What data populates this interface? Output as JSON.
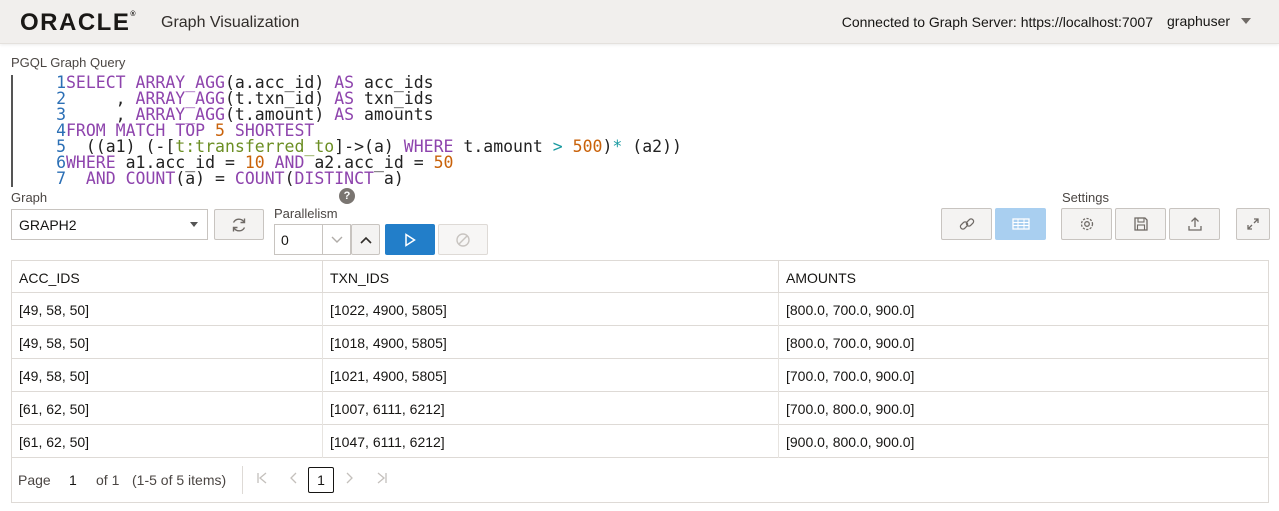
{
  "header": {
    "logo": "ORACLE",
    "logo_mark": "®",
    "app_title": "Graph Visualization",
    "connection": "Connected to Graph Server: https://localhost:7007",
    "user": "graphuser"
  },
  "query": {
    "label": "PGQL Graph Query",
    "lines": [
      {
        "n": "1",
        "parts": [
          "SELECT ",
          "ARRAY_AGG",
          "(a.acc_id) ",
          "AS",
          " acc_ids"
        ]
      },
      {
        "n": "2",
        "parts": [
          "     , ",
          "ARRAY_AGG",
          "(t.txn_id) ",
          "AS",
          " txn_ids"
        ]
      },
      {
        "n": "3",
        "parts": [
          "     , ",
          "ARRAY_AGG",
          "(t.amount) ",
          "AS",
          " amounts"
        ]
      },
      {
        "n": "4",
        "parts": [
          "FROM MATCH TOP ",
          "5",
          " SHORTEST"
        ]
      },
      {
        "n": "5",
        "parts": [
          "  ((a1) (-[",
          "t:transferred_to",
          "]->(a) ",
          "WHERE",
          " t.amount ",
          ">",
          " ",
          "500",
          ")",
          "*",
          " (a2))"
        ]
      },
      {
        "n": "6",
        "parts": [
          "WHERE",
          " a1.acc_id = ",
          "10",
          " ",
          "AND",
          " a2.acc_id = ",
          "50"
        ]
      },
      {
        "n": "7",
        "parts": [
          "  ",
          "AND COUNT",
          "(a) = ",
          "COUNT",
          "(",
          "DISTINCT",
          " a)"
        ]
      }
    ]
  },
  "controls": {
    "graph_label": "Graph",
    "graph_value": "GRAPH2",
    "parallelism_label": "Parallelism",
    "parallelism_value": "0",
    "help": "?",
    "settings_label": "Settings"
  },
  "table": {
    "columns": [
      "ACC_IDS",
      "TXN_IDS",
      "AMOUNTS"
    ],
    "rows": [
      [
        "[49, 58, 50]",
        "[1022, 4900, 5805]",
        "[800.0, 700.0, 900.0]"
      ],
      [
        "[49, 58, 50]",
        "[1018, 4900, 5805]",
        "[800.0, 700.0, 900.0]"
      ],
      [
        "[49, 58, 50]",
        "[1021, 4900, 5805]",
        "[700.0, 700.0, 900.0]"
      ],
      [
        "[61, 62, 50]",
        "[1007, 6111, 6212]",
        "[700.0, 800.0, 900.0]"
      ],
      [
        "[61, 62, 50]",
        "[1047, 6111, 6212]",
        "[900.0, 800.0, 900.0]"
      ]
    ]
  },
  "pagination": {
    "page_label": "Page",
    "page_value": "1",
    "of_label": "of 1",
    "items_label": "(1-5 of 5 items)",
    "current": "1"
  },
  "colors": {
    "primary": "#227ec9",
    "active": "#a9cff0",
    "keyword": "#8e44ad",
    "number": "#c9620a",
    "line_number": "#2b6fb5"
  }
}
